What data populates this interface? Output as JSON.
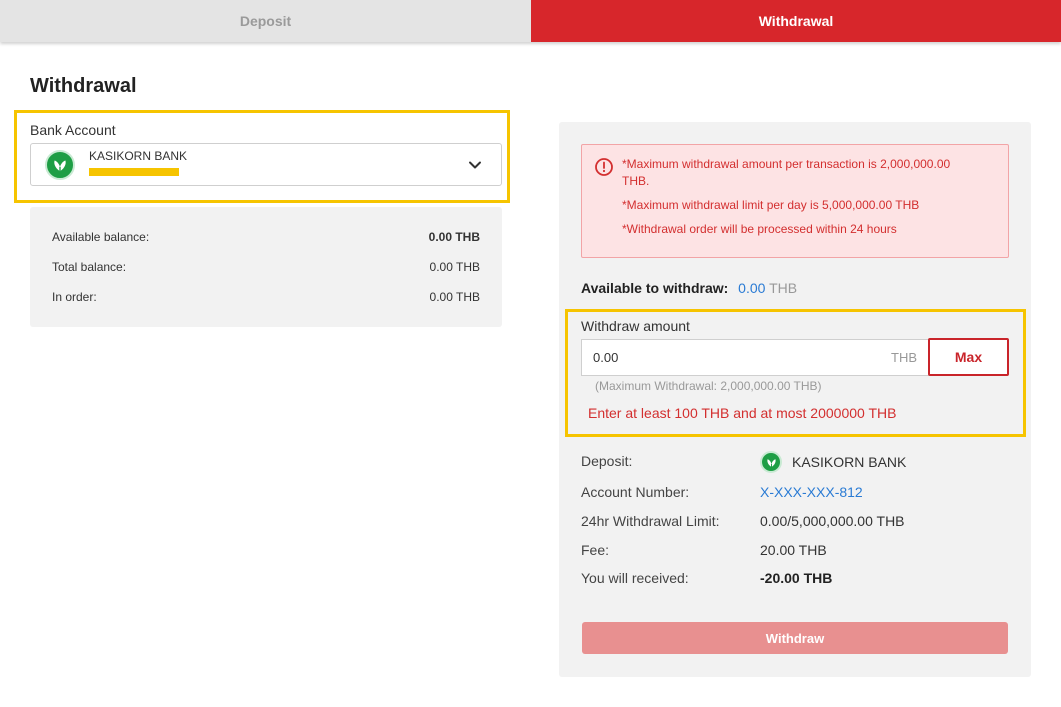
{
  "tabs": {
    "deposit": "Deposit",
    "withdrawal": "Withdrawal"
  },
  "page_title": "Withdrawal",
  "bank_account": {
    "label": "Bank Account",
    "selected_bank": "KASIKORN BANK",
    "icon": "kasikorn-bank-logo-icon"
  },
  "balance": {
    "available_label": "Available balance:",
    "available_value": "0.00 THB",
    "total_label": "Total balance:",
    "total_value": "0.00 THB",
    "in_order_label": "In order:",
    "in_order_value": "0.00 THB"
  },
  "alert": {
    "icon": "error-circle-icon",
    "line1": "*Maximum withdrawal amount per transaction is 2,000,000.00",
    "line1b": "THB.",
    "line2": "*Maximum withdrawal limit per day is 5,000,000.00 THB",
    "line3": "*Withdrawal order will be processed within 24 hours"
  },
  "available_to_withdraw": {
    "label": "Available to withdraw:",
    "value": "0.00",
    "unit": "THB"
  },
  "withdraw_amount": {
    "label": "Withdraw amount",
    "value": "0.00",
    "unit": "THB",
    "max_label": "Max",
    "hint": "(Maximum Withdrawal: 2,000,000.00 THB)",
    "error": "Enter at least 100 THB and at most 2000000 THB"
  },
  "details": {
    "deposit_label": "Deposit:",
    "deposit_bank": "KASIKORN BANK",
    "account_number_label": "Account Number:",
    "account_number": "X-XXX-XXX-812",
    "limit_label": "24hr Withdrawal Limit:",
    "limit_value": "0.00/5,000,000.00 THB",
    "fee_label": "Fee:",
    "fee_value": "20.00 THB",
    "receive_label": "You will received:",
    "receive_value": "-20.00 THB"
  },
  "withdraw_button": "Withdraw",
  "colors": {
    "brand_red": "#d7262b",
    "highlight_yellow": "#f6c400",
    "link_blue": "#2a7bd4",
    "bank_green": "#1e9e45"
  }
}
